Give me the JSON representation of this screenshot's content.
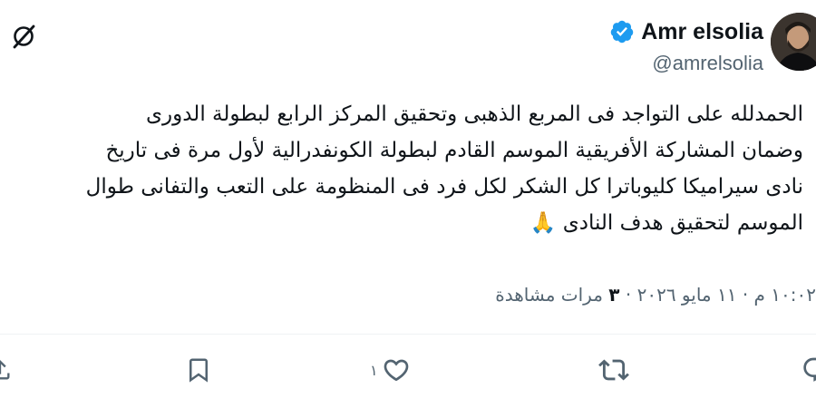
{
  "author": {
    "display_name": "Amr elsolia",
    "handle": "@amrelsolia",
    "verified_icon": "verified-badge-icon",
    "avatar_icon": "profile-avatar"
  },
  "tweet": {
    "lines": [
      "الحمدلله على التواجد فى المربع الذهبى وتحقيق المركز الرابع لبطولة الدورى",
      "وضمان المشاركة الأفريقية الموسم القادم لبطولة الكونفدرالية لأول مرة فى تاريخ",
      "نادى سيراميكا كليوباترا كل الشكر لكل فرد فى المنظومة على التعب والتفانى طوال",
      "الموسم لتحقيق هدف النادى 🙏"
    ]
  },
  "meta": {
    "time_date": "١٠:٠٢ م · ١١ مايو ٢٠٢٦ ·",
    "views_count": "٣",
    "views_label": "مرات مشاهدة"
  },
  "actions": {
    "like_count": "١",
    "icons": [
      "reply-icon",
      "retweet-icon",
      "like-icon",
      "bookmark-icon",
      "share-icon"
    ]
  },
  "header": {
    "grok_icon": "grok-icon"
  },
  "colors": {
    "text_primary": "#0f1419",
    "text_secondary": "#536471",
    "verified_blue": "#1d9bf0",
    "divider": "#eff3f4"
  }
}
